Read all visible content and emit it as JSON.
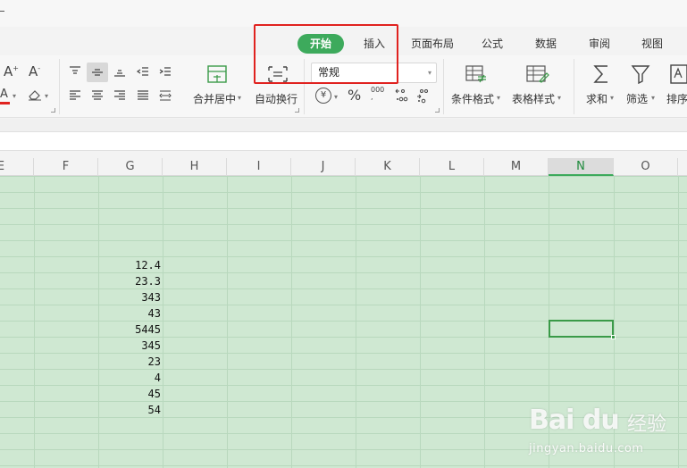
{
  "ribbon_tabs": {
    "start": "开始",
    "insert": "插入",
    "page_layout": "页面布局",
    "formula": "公式",
    "data": "数据",
    "review": "审阅",
    "view": "视图"
  },
  "ribbon": {
    "merge_center": "合并居中",
    "auto_wrap": "自动换行",
    "number_format": "常规",
    "conditional_format": "条件格式",
    "table_style": "表格样式",
    "sum": "求和",
    "filter": "筛选",
    "sort": "排序",
    "percent_symbol": "%",
    "thousands_symbol": "000",
    "currency_symbol": "¥"
  },
  "columns": [
    "E",
    "F",
    "G",
    "H",
    "I",
    "J",
    "K",
    "L",
    "M",
    "N",
    "O"
  ],
  "selected_column": "N",
  "cells_G": [
    "12.4",
    "23.3",
    "343",
    "43",
    "5445",
    "345",
    "23",
    "4",
    "45",
    "54"
  ],
  "watermark": {
    "logo": "Bai du",
    "brand": "经验",
    "url": "jingyan.baidu.com"
  },
  "colors": {
    "accent": "#3daa5c",
    "highlight_box": "#e0221f",
    "sheet_bg": "#cfe8d2"
  }
}
